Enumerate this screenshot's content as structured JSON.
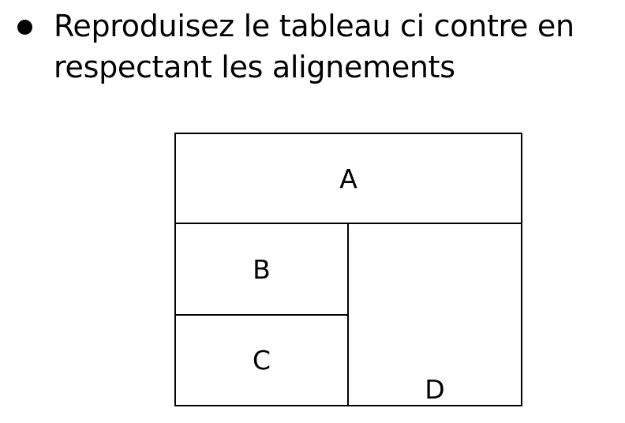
{
  "instruction": {
    "text": "Reproduisez le tableau ci contre en respectant les alignements"
  },
  "table": {
    "cells": {
      "a": "A",
      "b": "B",
      "c": "C",
      "d": "D"
    }
  }
}
